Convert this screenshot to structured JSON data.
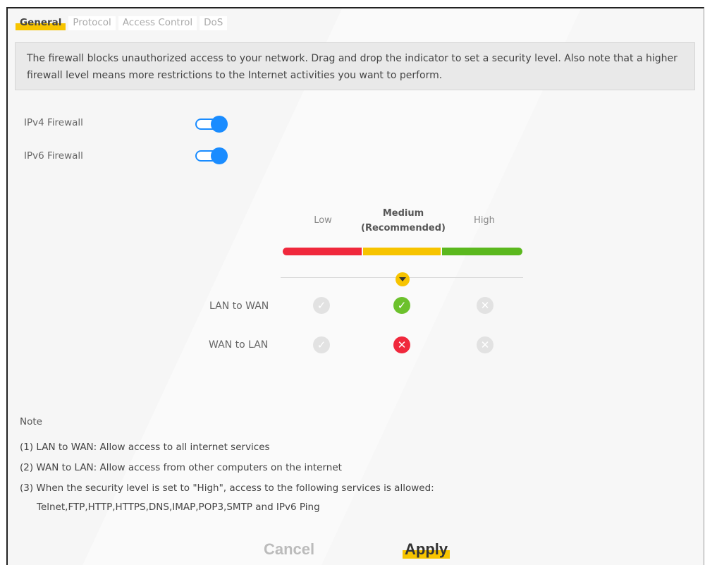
{
  "tabs": [
    {
      "label": "General"
    },
    {
      "label": "Protocol"
    },
    {
      "label": "Access Control"
    },
    {
      "label": "DoS"
    }
  ],
  "description": "The firewall blocks unauthorized access to your network. Drag and drop the indicator to set a security level. Also note that a higher firewall level means more restrictions to the Internet activities you want to perform.",
  "firewall": {
    "ipv4_label": "IPv4 Firewall",
    "ipv4_enabled": true,
    "ipv6_label": "IPv6 Firewall",
    "ipv6_enabled": true
  },
  "levels": {
    "low": "Low",
    "medium_line1": "Medium",
    "medium_line2": "(Recommended)",
    "high": "High",
    "selected": "Medium",
    "colors": {
      "low": "#f0283c",
      "medium": "#f7c400",
      "high": "#5bb81e"
    }
  },
  "matrix": {
    "lan_to_wan_label": "LAN to WAN",
    "wan_to_lan_label": "WAN to LAN",
    "lan_to_wan_icons": [
      "check-icon",
      "check-icon",
      "cross-icon"
    ],
    "wan_to_lan_icons": [
      "check-icon",
      "cross-icon",
      "cross-icon"
    ]
  },
  "notes": {
    "title": "Note",
    "items": [
      "(1) LAN to WAN: Allow access to all internet services",
      "(2) WAN to LAN: Allow access from other computers on the internet",
      "(3) When the security level is set to \"High\", access to the following services is allowed:",
      "Telnet,FTP,HTTP,HTTPS,DNS,IMAP,POP3,SMTP and IPv6 Ping"
    ]
  },
  "buttons": {
    "cancel": "Cancel",
    "apply": "Apply"
  }
}
